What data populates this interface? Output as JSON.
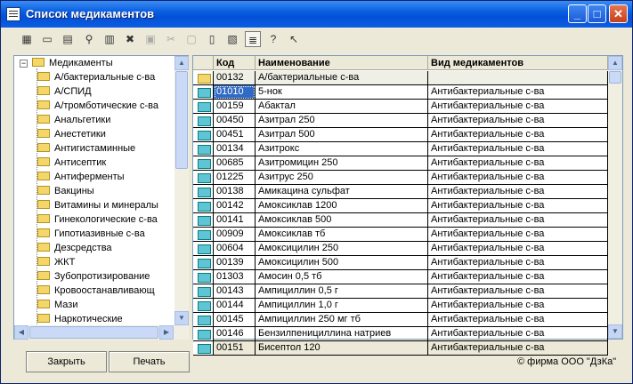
{
  "window": {
    "title": "Список медикаментов"
  },
  "tree": {
    "root": "Медикаменты",
    "items": [
      "А/бактериальные с-ва",
      "А/СПИД",
      "А/тромботические с-ва",
      "Анальгетики",
      "Анестетики",
      "Антигистаминные",
      "Антисептик",
      "Антиферменты",
      "Вакцины",
      "Витамины и минералы",
      "Гинекологические с-ва",
      "Гипотиазивные с-ва",
      "Дезсредства",
      "ЖКТ",
      "Зубопротизирование",
      "Кровоостанавливающ",
      "Мази",
      "Наркотические"
    ]
  },
  "grid": {
    "columns": [
      "Код",
      "Наименование",
      "Вид медикаментов"
    ],
    "rows": [
      {
        "code": "00132",
        "name": "А/бактериальные с-ва",
        "type": "",
        "icon": "folder"
      },
      {
        "code": "01010",
        "name": "5-нок",
        "type": "Антибактериальные с-ва",
        "icon": "item",
        "selected": true
      },
      {
        "code": "00159",
        "name": "Абактал",
        "type": "Антибактериальные с-ва",
        "icon": "item"
      },
      {
        "code": "00450",
        "name": "Азитрал 250",
        "type": "Антибактериальные с-ва",
        "icon": "item"
      },
      {
        "code": "00451",
        "name": "Азитрал 500",
        "type": "Антибактериальные с-ва",
        "icon": "item"
      },
      {
        "code": "00134",
        "name": "Азитрокс",
        "type": "Антибактериальные с-ва",
        "icon": "item"
      },
      {
        "code": "00685",
        "name": "Азитромицин 250",
        "type": "Антибактериальные с-ва",
        "icon": "item"
      },
      {
        "code": "01225",
        "name": "Азитрус 250",
        "type": "Антибактериальные с-ва",
        "icon": "item"
      },
      {
        "code": "00138",
        "name": "Амикацина сульфат",
        "type": "Антибактериальные с-ва",
        "icon": "item"
      },
      {
        "code": "00142",
        "name": "Амоксиклав 1200",
        "type": "Антибактериальные с-ва",
        "icon": "item"
      },
      {
        "code": "00141",
        "name": "Амоксиклав 500",
        "type": "Антибактериальные с-ва",
        "icon": "item"
      },
      {
        "code": "00909",
        "name": "Амоксиклав тб",
        "type": "Антибактериальные с-ва",
        "icon": "item"
      },
      {
        "code": "00604",
        "name": "Амоксицилин 250",
        "type": "Антибактериальные с-ва",
        "icon": "item"
      },
      {
        "code": "00139",
        "name": "Амоксицилин 500",
        "type": "Антибактериальные с-ва",
        "icon": "item"
      },
      {
        "code": "01303",
        "name": "Амосин 0,5 тб",
        "type": "Антибактериальные с-ва",
        "icon": "item"
      },
      {
        "code": "00143",
        "name": "Ампициллин 0,5 г",
        "type": "Антибактериальные с-ва",
        "icon": "item"
      },
      {
        "code": "00144",
        "name": "Ампициллин 1,0 г",
        "type": "Антибактериальные с-ва",
        "icon": "item"
      },
      {
        "code": "00145",
        "name": "Ампициллин 250 мг тб",
        "type": "Антибактериальные с-ва",
        "icon": "item"
      },
      {
        "code": "00146",
        "name": "Бензилпенициллина натриев",
        "type": "Антибактериальные с-ва",
        "icon": "item"
      },
      {
        "code": "00151",
        "name": "Бисептол 120",
        "type": "Антибактериальные с-ва",
        "icon": "item"
      }
    ]
  },
  "footer": {
    "close_label": "Закрыть",
    "print_label": "Печать",
    "copyright": "© фирма ООО \"ДзКа\""
  },
  "colors": {
    "titlebar": "#0a5fe0",
    "selection": "#316ac5",
    "window_bg": "#ece9d8"
  }
}
